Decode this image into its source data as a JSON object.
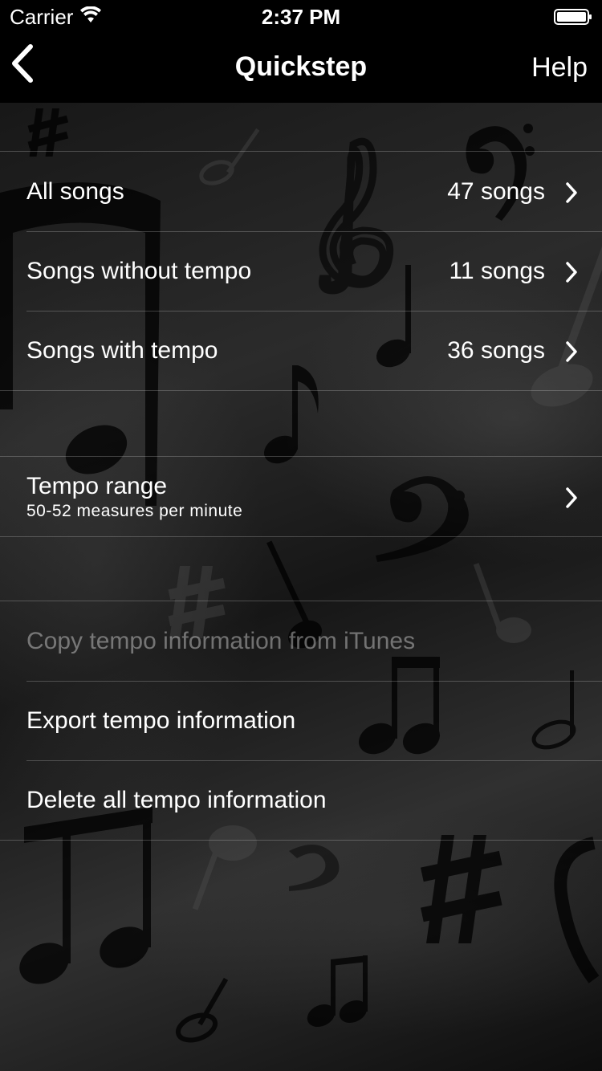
{
  "status_bar": {
    "carrier": "Carrier",
    "time": "2:37 PM"
  },
  "nav": {
    "title": "Quickstep",
    "help_label": "Help",
    "back_icon": "chevron-left-icon"
  },
  "song_groups": [
    {
      "label": "All songs",
      "value": "47 songs"
    },
    {
      "label": "Songs without tempo",
      "value": "11 songs"
    },
    {
      "label": "Songs with tempo",
      "value": "36 songs"
    }
  ],
  "tempo_range": {
    "label": "Tempo range",
    "subtitle": "50-52 measures per minute"
  },
  "actions": [
    {
      "label": "Copy tempo information from iTunes",
      "enabled": false
    },
    {
      "label": "Export tempo information",
      "enabled": true
    },
    {
      "label": "Delete all tempo information",
      "enabled": true
    }
  ],
  "colors": {
    "background": "#000000",
    "text": "#ffffff",
    "disabled_text": "#5e5e5e",
    "separator": "#3a3a3a"
  }
}
